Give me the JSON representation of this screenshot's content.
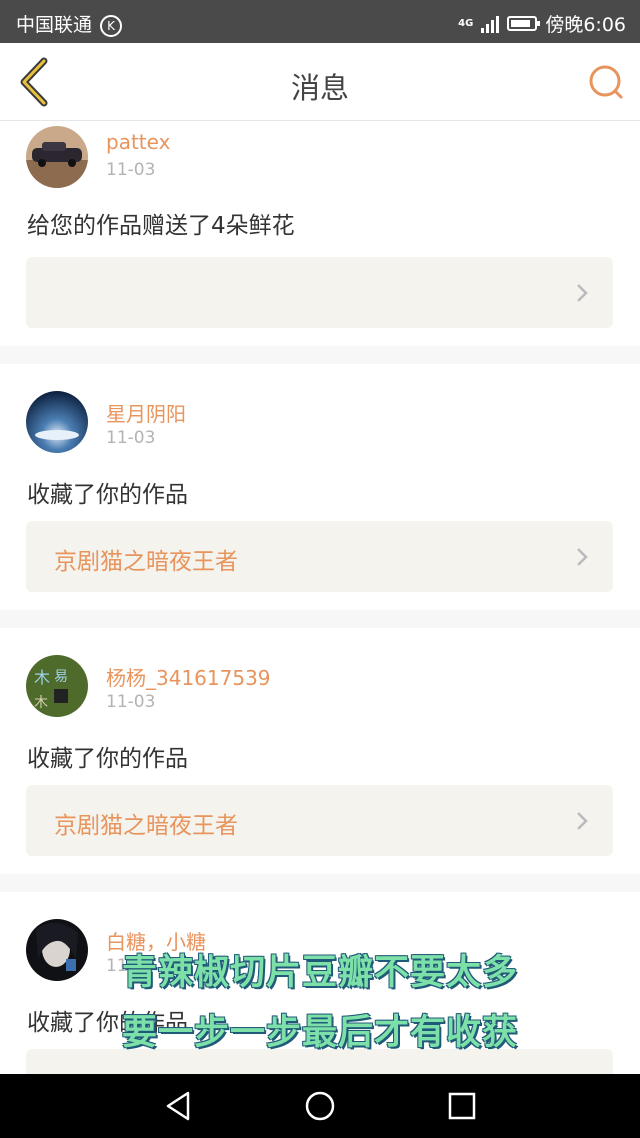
{
  "status_bar": {
    "carrier": "中国联通",
    "carrier_badge": "K",
    "network": "4G",
    "time": "傍晚6:06",
    "battery_level": 0.85
  },
  "header": {
    "title": "消息",
    "back_icon": "chevron-left-icon",
    "search_icon": "search-icon"
  },
  "messages": [
    {
      "user": "pattex",
      "date": "11-03",
      "action": "给您的作品赠送了4朵鲜花",
      "work": ""
    },
    {
      "user": "星月阴阳",
      "date": "11-03",
      "action": "收藏了你的作品",
      "work": "京剧猫之暗夜王者"
    },
    {
      "user": "杨杨_341617539",
      "date": "11-03",
      "action": "收藏了你的作品",
      "work": "京剧猫之暗夜王者"
    },
    {
      "user": "白糖，小糖",
      "date": "11-03",
      "action": "收藏了你的作品",
      "work": ""
    }
  ],
  "overlay_subtitles": [
    "青辣椒切片豆瓣不要太多",
    "要一步一步最后才有收获"
  ],
  "colors": {
    "accent": "#e8945d",
    "statusbar": "#4a4a4a",
    "box": "#f4f3ee"
  },
  "nav_bar": {
    "back_icon": "triangle-back-icon",
    "home_icon": "circle-home-icon",
    "recent_icon": "square-recent-icon"
  }
}
